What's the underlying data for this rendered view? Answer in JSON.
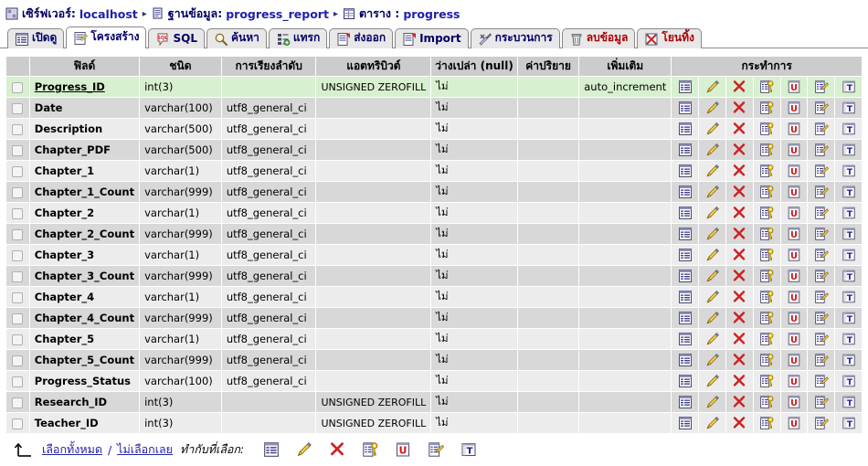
{
  "breadcrumb": {
    "server_label": "เซิร์ฟเวอร์:",
    "server_value": "localhost",
    "db_label": "ฐานข้อมูล:",
    "db_value": "progress_report",
    "table_label": "ตาราง :",
    "table_value": "progress",
    "separator": "▸"
  },
  "tabs": [
    {
      "label": "เปิดดู",
      "icon": "browse-icon",
      "active": false,
      "red": false
    },
    {
      "label": "โครงสร้าง",
      "icon": "structure-icon",
      "active": true,
      "red": false
    },
    {
      "label": "SQL",
      "icon": "sql-icon",
      "active": false,
      "red": false
    },
    {
      "label": "ค้นหา",
      "icon": "search-icon",
      "active": false,
      "red": false
    },
    {
      "label": "แทรก",
      "icon": "insert-icon",
      "active": false,
      "red": false
    },
    {
      "label": "ส่งออก",
      "icon": "export-icon",
      "active": false,
      "red": false
    },
    {
      "label": "Import",
      "icon": "import-icon",
      "active": false,
      "red": false
    },
    {
      "label": "กระบวนการ",
      "icon": "operations-icon",
      "active": false,
      "red": false
    },
    {
      "label": "ลบข้อมูล",
      "icon": "empty-icon",
      "active": false,
      "red": true
    },
    {
      "label": "โยนทิ้ง",
      "icon": "drop-icon",
      "active": false,
      "red": true
    }
  ],
  "table": {
    "headers": {
      "field": "ฟิลด์",
      "type": "ชนิด",
      "collation": "การเรียงลำดับ",
      "attributes": "แอตทริบิวต์",
      "null": "ว่างเปล่า (null)",
      "default": "ค่าปริยาย",
      "extra": "เพิ่มเติม",
      "action": "กระทำการ"
    },
    "null_no": "ไม่",
    "rows": [
      {
        "field": "Progress_ID",
        "pk": true,
        "type": "int(3)",
        "collation": "",
        "attributes": "UNSIGNED ZEROFILL",
        "null": "ไม่",
        "default": "",
        "extra": "auto_increment",
        "highlight": true
      },
      {
        "field": "Date",
        "pk": false,
        "type": "varchar(100)",
        "collation": "utf8_general_ci",
        "attributes": "",
        "null": "ไม่",
        "default": "",
        "extra": "",
        "highlight": false
      },
      {
        "field": "Description",
        "pk": false,
        "type": "varchar(500)",
        "collation": "utf8_general_ci",
        "attributes": "",
        "null": "ไม่",
        "default": "",
        "extra": "",
        "highlight": false
      },
      {
        "field": "Chapter_PDF",
        "pk": false,
        "type": "varchar(500)",
        "collation": "utf8_general_ci",
        "attributes": "",
        "null": "ไม่",
        "default": "",
        "extra": "",
        "highlight": false
      },
      {
        "field": "Chapter_1",
        "pk": false,
        "type": "varchar(1)",
        "collation": "utf8_general_ci",
        "attributes": "",
        "null": "ไม่",
        "default": "",
        "extra": "",
        "highlight": false
      },
      {
        "field": "Chapter_1_Count",
        "pk": false,
        "type": "varchar(999)",
        "collation": "utf8_general_ci",
        "attributes": "",
        "null": "ไม่",
        "default": "",
        "extra": "",
        "highlight": false
      },
      {
        "field": "Chapter_2",
        "pk": false,
        "type": "varchar(1)",
        "collation": "utf8_general_ci",
        "attributes": "",
        "null": "ไม่",
        "default": "",
        "extra": "",
        "highlight": false
      },
      {
        "field": "Chapter_2_Count",
        "pk": false,
        "type": "varchar(999)",
        "collation": "utf8_general_ci",
        "attributes": "",
        "null": "ไม่",
        "default": "",
        "extra": "",
        "highlight": false
      },
      {
        "field": "Chapter_3",
        "pk": false,
        "type": "varchar(1)",
        "collation": "utf8_general_ci",
        "attributes": "",
        "null": "ไม่",
        "default": "",
        "extra": "",
        "highlight": false
      },
      {
        "field": "Chapter_3_Count",
        "pk": false,
        "type": "varchar(999)",
        "collation": "utf8_general_ci",
        "attributes": "",
        "null": "ไม่",
        "default": "",
        "extra": "",
        "highlight": false
      },
      {
        "field": "Chapter_4",
        "pk": false,
        "type": "varchar(1)",
        "collation": "utf8_general_ci",
        "attributes": "",
        "null": "ไม่",
        "default": "",
        "extra": "",
        "highlight": false
      },
      {
        "field": "Chapter_4_Count",
        "pk": false,
        "type": "varchar(999)",
        "collation": "utf8_general_ci",
        "attributes": "",
        "null": "ไม่",
        "default": "",
        "extra": "",
        "highlight": false
      },
      {
        "field": "Chapter_5",
        "pk": false,
        "type": "varchar(1)",
        "collation": "utf8_general_ci",
        "attributes": "",
        "null": "ไม่",
        "default": "",
        "extra": "",
        "highlight": false
      },
      {
        "field": "Chapter_5_Count",
        "pk": false,
        "type": "varchar(999)",
        "collation": "utf8_general_ci",
        "attributes": "",
        "null": "ไม่",
        "default": "",
        "extra": "",
        "highlight": false
      },
      {
        "field": "Progress_Status",
        "pk": false,
        "type": "varchar(100)",
        "collation": "utf8_general_ci",
        "attributes": "",
        "null": "ไม่",
        "default": "",
        "extra": "",
        "highlight": false
      },
      {
        "field": "Research_ID",
        "pk": false,
        "type": "int(3)",
        "collation": "",
        "attributes": "UNSIGNED ZEROFILL",
        "null": "ไม่",
        "default": "",
        "extra": "",
        "highlight": false
      },
      {
        "field": "Teacher_ID",
        "pk": false,
        "type": "int(3)",
        "collation": "",
        "attributes": "UNSIGNED ZEROFILL",
        "null": "ไม่",
        "default": "",
        "extra": "",
        "highlight": false
      }
    ],
    "row_actions": [
      "browse-distinct-icon",
      "edit-pencil-icon",
      "drop-x-icon",
      "primary-key-icon",
      "unique-index-icon",
      "index-icon",
      "fulltext-icon"
    ]
  },
  "footer": {
    "arrow_icon": "check-all-arrow-icon",
    "select_all": "เลือกทั้งหมด",
    "separator": "/",
    "unselect_all": "ไม่เลือกเลย",
    "with_selected": "ทำกับที่เลือก:",
    "actions": [
      "browse-distinct-icon",
      "edit-pencil-icon",
      "drop-x-icon",
      "primary-key-icon",
      "unique-index-icon",
      "index-icon",
      "fulltext-icon"
    ]
  },
  "colors": {
    "highlight_row": "#d7f0cf",
    "odd_row": "#ececec",
    "even_row": "#d8d8d8",
    "header": "#cccccc",
    "link": "#2222aa",
    "breadcrumb": "#000066"
  }
}
